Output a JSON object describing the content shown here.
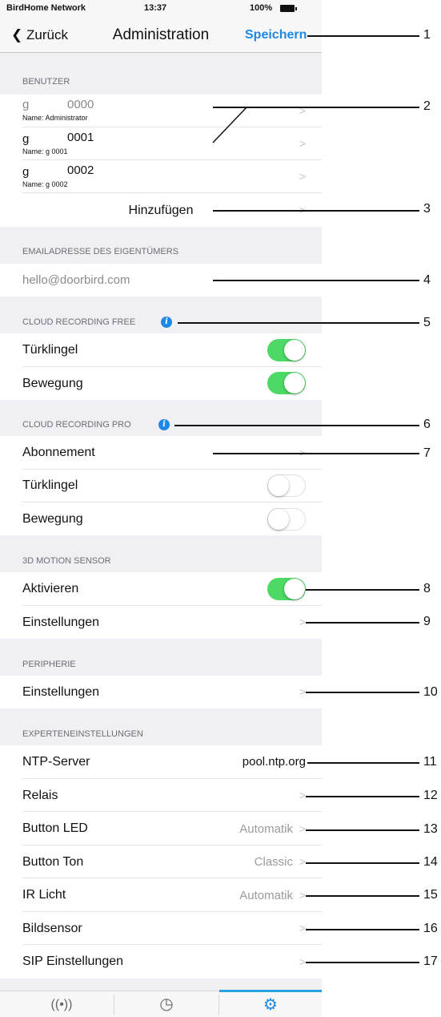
{
  "status_bar": {
    "carrier": "BirdHome Network",
    "time": "13:37",
    "battery": "100%"
  },
  "nav": {
    "back_label": "Zurück",
    "title": "Administration",
    "save_label": "Speichern"
  },
  "sections": {
    "users": "BENUTZER",
    "owner_email": "EMAILADRESSE DES EIGENTÜMERS",
    "cloud_free": "CLOUD RECORDING FREE",
    "cloud_pro": "CLOUD RECORDING PRO",
    "motion": "3D MOTION SENSOR",
    "periphery": "PERIPHERIE",
    "expert": "EXPERTENEINSTELLUNGEN"
  },
  "users": [
    {
      "letter": "g",
      "number": "0000",
      "name": "Name: Administrator"
    },
    {
      "letter": "g",
      "number": "0001",
      "name": "Name: g       0001"
    },
    {
      "letter": "g",
      "number": "0002",
      "name": "Name: g       0002"
    }
  ],
  "add_user_label": "Hinzufügen",
  "owner_email_value": "hello@doorbird.com",
  "cloud_free": {
    "doorbell": "Türklingel",
    "doorbell_on": true,
    "motion": "Bewegung",
    "motion_on": true
  },
  "cloud_pro": {
    "subscription": "Abonnement",
    "doorbell": "Türklingel",
    "doorbell_on": false,
    "motion": "Bewegung",
    "motion_on": false
  },
  "motion_sensor": {
    "activate": "Aktivieren",
    "activate_on": true,
    "settings": "Einstellungen"
  },
  "periphery": {
    "settings": "Einstellungen"
  },
  "expert": {
    "ntp_label": "NTP-Server",
    "ntp_value": "pool.ntp.org",
    "relay_label": "Relais",
    "button_led_label": "Button LED",
    "button_led_value": "Automatik",
    "button_tone_label": "Button Ton",
    "button_tone_value": "Classic",
    "ir_label": "IR Licht",
    "ir_value": "Automatik",
    "image_sensor_label": "Bildsensor",
    "sip_label": "SIP Einstellungen"
  },
  "info_glyph": "i",
  "chevron_glyph": ">",
  "callout_numbers": [
    "1",
    "2",
    "3",
    "4",
    "5",
    "6",
    "7",
    "8",
    "9",
    "10",
    "11",
    "12",
    "13",
    "14",
    "15",
    "16",
    "17"
  ],
  "tabs": [
    {
      "icon": "broadcast-icon",
      "glyph": "((•))"
    },
    {
      "icon": "history-icon",
      "glyph": "◷"
    },
    {
      "icon": "settings-gear-icon",
      "glyph": "⚙"
    }
  ],
  "colors": {
    "accent": "#1e88e5",
    "toggle_on": "#4cd964",
    "background": "#efeff4"
  }
}
